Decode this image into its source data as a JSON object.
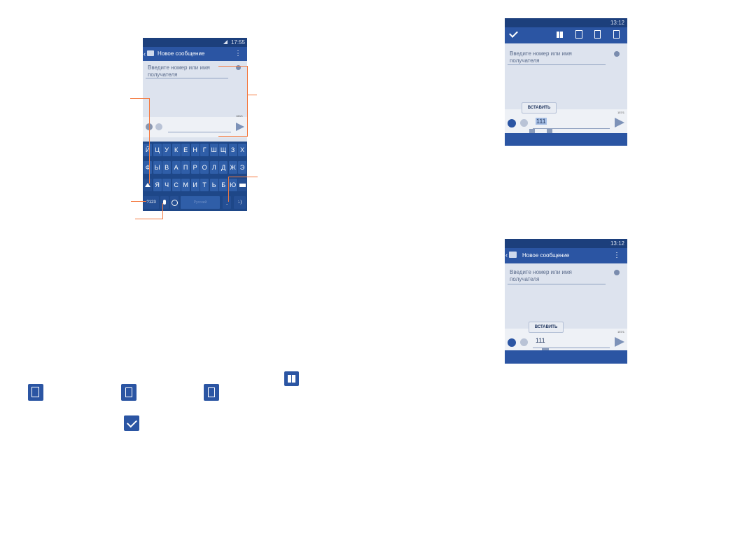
{
  "phone1": {
    "status_time": "17:55",
    "title": "Новое сообщение",
    "recipient_placeholder_line1": "Введите номер или имя",
    "recipient_placeholder_line2": "получателя",
    "char_counter": "160/1",
    "keyboard": {
      "row1": [
        "Й",
        "Ц",
        "У",
        "К",
        "Е",
        "Н",
        "Г",
        "Ш",
        "Щ",
        "З",
        "Х"
      ],
      "row2": [
        "Ф",
        "Ы",
        "В",
        "А",
        "П",
        "Р",
        "О",
        "Л",
        "Д",
        "Ж",
        "Э"
      ],
      "row3": [
        "Я",
        "Ч",
        "С",
        "М",
        "И",
        "Т",
        "Ь",
        "Б",
        "Ю"
      ],
      "mode_key": "?123",
      "space_label": "Русский",
      "dot_key": ".",
      "smiley_key": ":-)"
    }
  },
  "phone2": {
    "status_time": "13:12",
    "recipient_placeholder_line1": "Введите номер или имя",
    "recipient_placeholder_line2": "получателя",
    "paste_label": "ВСТАВИТЬ",
    "message_text": "111",
    "char_counter": "157/1"
  },
  "phone3": {
    "status_time": "13:12",
    "title": "Новое сообщение",
    "recipient_placeholder_line1": "Введите номер или имя",
    "recipient_placeholder_line2": "получателя",
    "paste_label": "ВСТАВИТЬ",
    "message_text": "111",
    "char_counter": "157/1"
  },
  "colors": {
    "appbar": "#2b55a3",
    "statusbar": "#1c3f7c",
    "callout": "#f47b42",
    "keyboard": "#1e4788"
  },
  "icons": [
    "select-all-icon",
    "cut-icon",
    "copy-icon",
    "paste-icon",
    "done-check-icon"
  ]
}
